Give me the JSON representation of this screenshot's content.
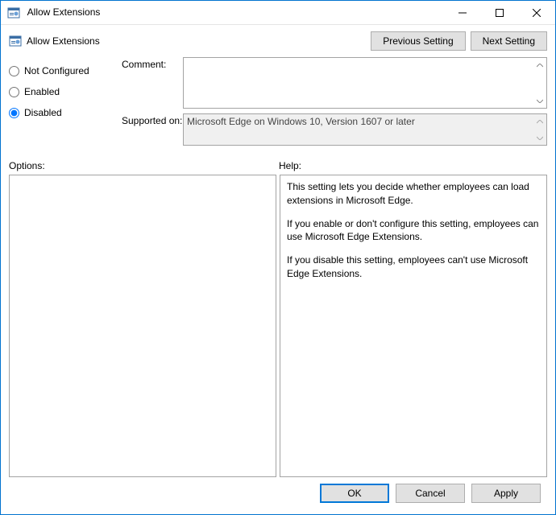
{
  "window": {
    "title": "Allow Extensions"
  },
  "subheader": {
    "title": "Allow Extensions",
    "prev_btn": "Previous Setting",
    "next_btn": "Next Setting"
  },
  "radios": {
    "not_configured": "Not Configured",
    "enabled": "Enabled",
    "disabled": "Disabled",
    "selected": "disabled"
  },
  "comment": {
    "label": "Comment:",
    "value": ""
  },
  "supported": {
    "label": "Supported on:",
    "value": "Microsoft Edge on Windows 10, Version 1607 or later"
  },
  "options": {
    "label": "Options:"
  },
  "help": {
    "label": "Help:",
    "p1": "This setting lets you decide whether employees can load extensions in Microsoft Edge.",
    "p2": "If you enable or don't configure this setting, employees can use Microsoft Edge Extensions.",
    "p3": "If you disable this setting, employees can't use Microsoft Edge Extensions."
  },
  "footer": {
    "ok": "OK",
    "cancel": "Cancel",
    "apply": "Apply"
  }
}
